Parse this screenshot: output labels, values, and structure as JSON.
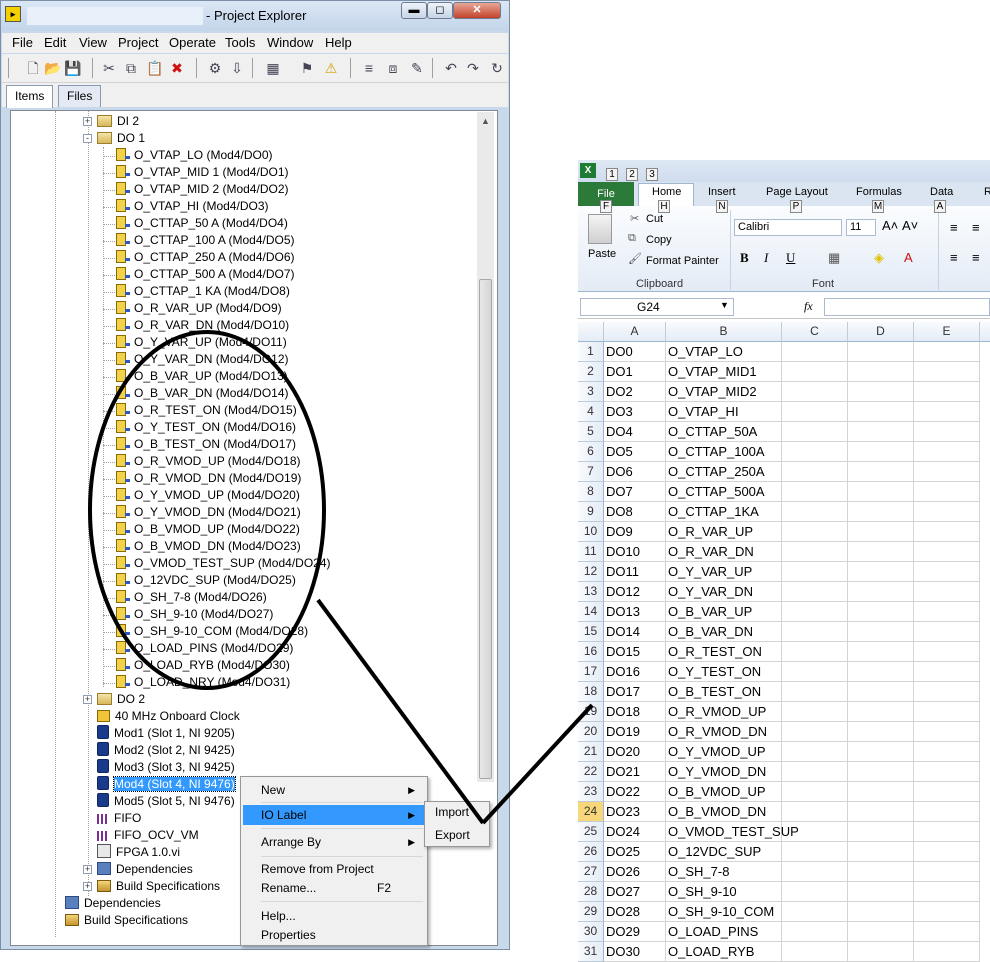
{
  "project_explorer": {
    "title": "- Project Explorer",
    "window_buttons": {
      "minimize": "▬",
      "maximize": "◻",
      "close": "✕"
    },
    "menu": [
      "File",
      "Edit",
      "View",
      "Project",
      "Operate",
      "Tools",
      "Window",
      "Help"
    ],
    "tabs": {
      "items": "Items",
      "files": "Files"
    },
    "tree": {
      "di2": "DI 2",
      "do1": "DO 1",
      "do1_items": [
        "O_VTAP_LO (Mod4/DO0)",
        "O_VTAP_MID 1 (Mod4/DO1)",
        "O_VTAP_MID 2 (Mod4/DO2)",
        "O_VTAP_HI (Mod4/DO3)",
        "O_CTTAP_50 A (Mod4/DO4)",
        "O_CTTAP_100 A (Mod4/DO5)",
        "O_CTTAP_250 A (Mod4/DO6)",
        "O_CTTAP_500 A (Mod4/DO7)",
        "O_CTTAP_1 KA (Mod4/DO8)",
        "O_R_VAR_UP (Mod4/DO9)",
        "O_R_VAR_DN (Mod4/DO10)",
        "O_Y_VAR_UP (Mod4/DO11)",
        "O_Y_VAR_DN (Mod4/DO12)",
        "O_B_VAR_UP (Mod4/DO13)",
        "O_B_VAR_DN (Mod4/DO14)",
        "O_R_TEST_ON (Mod4/DO15)",
        "O_Y_TEST_ON (Mod4/DO16)",
        "O_B_TEST_ON (Mod4/DO17)",
        "O_R_VMOD_UP (Mod4/DO18)",
        "O_R_VMOD_DN (Mod4/DO19)",
        "O_Y_VMOD_UP (Mod4/DO20)",
        "O_Y_VMOD_DN (Mod4/DO21)",
        "O_B_VMOD_UP (Mod4/DO22)",
        "O_B_VMOD_DN (Mod4/DO23)",
        "O_VMOD_TEST_SUP (Mod4/DO24)",
        "O_12VDC_SUP (Mod4/DO25)",
        "O_SH_7-8 (Mod4/DO26)",
        "O_SH_9-10 (Mod4/DO27)",
        "O_SH_9-10_COM (Mod4/DO28)",
        "O_LOAD_PINS (Mod4/DO29)",
        "O_LOAD_RYB (Mod4/DO30)",
        "O_LOAD_NRY (Mod4/DO31)"
      ],
      "do2": "DO 2",
      "clock": "40 MHz Onboard Clock",
      "modules": [
        "Mod1 (Slot 1, NI 9205)",
        "Mod2 (Slot 2, NI 9425)",
        "Mod3 (Slot 3, NI 9425)",
        "Mod4 (Slot 4, NI 9476)",
        "Mod5 (Slot 5, NI 9476)"
      ],
      "fifo": "FIFO",
      "fifo_ocv": "FIFO_OCV_VM",
      "fpga_vi": "FPGA 1.0.vi",
      "dependencies_inner": "Dependencies",
      "build_specs_inner": "Build Specifications",
      "dependencies_outer": "Dependencies",
      "build_specs_outer": "Build Specifications"
    },
    "context_menu": {
      "new": "New",
      "io_label": "IO Label",
      "arrange_by": "Arrange By",
      "remove": "Remove from Project",
      "rename": "Rename...",
      "rename_shortcut": "F2",
      "help": "Help...",
      "properties": "Properties"
    },
    "submenu": {
      "import": "Import",
      "export": "Export"
    }
  },
  "excel": {
    "qat_keytips": [
      "1",
      "2",
      "3"
    ],
    "tabs": {
      "file": "File",
      "home": "Home",
      "insert": "Insert",
      "page_layout": "Page Layout",
      "formulas": "Formulas",
      "data": "Data",
      "r": "R"
    },
    "tab_keytips": {
      "file": "F",
      "home": "H",
      "insert": "N",
      "page_layout": "P",
      "formulas": "M",
      "data": "A"
    },
    "clipboard": {
      "paste": "Paste",
      "cut": "Cut",
      "copy": "Copy",
      "format_painter": "Format Painter",
      "label": "Clipboard"
    },
    "font": {
      "name": "Calibri",
      "size": "11",
      "bold": "B",
      "italic": "I",
      "underline": "U",
      "label": "Font"
    },
    "name_box": "G24",
    "fx": "fx",
    "columns": [
      "A",
      "B",
      "C",
      "D",
      "E"
    ],
    "active_row": 24,
    "rows": [
      {
        "n": "1",
        "a": "DO0",
        "b": "O_VTAP_LO"
      },
      {
        "n": "2",
        "a": "DO1",
        "b": "O_VTAP_MID1"
      },
      {
        "n": "3",
        "a": "DO2",
        "b": "O_VTAP_MID2"
      },
      {
        "n": "4",
        "a": "DO3",
        "b": "O_VTAP_HI"
      },
      {
        "n": "5",
        "a": "DO4",
        "b": "O_CTTAP_50A"
      },
      {
        "n": "6",
        "a": "DO5",
        "b": "O_CTTAP_100A"
      },
      {
        "n": "7",
        "a": "DO6",
        "b": "O_CTTAP_250A"
      },
      {
        "n": "8",
        "a": "DO7",
        "b": "O_CTTAP_500A"
      },
      {
        "n": "9",
        "a": "DO8",
        "b": "O_CTTAP_1KA"
      },
      {
        "n": "10",
        "a": "DO9",
        "b": "O_R_VAR_UP"
      },
      {
        "n": "11",
        "a": "DO10",
        "b": "O_R_VAR_DN"
      },
      {
        "n": "12",
        "a": "DO11",
        "b": "O_Y_VAR_UP"
      },
      {
        "n": "13",
        "a": "DO12",
        "b": "O_Y_VAR_DN"
      },
      {
        "n": "14",
        "a": "DO13",
        "b": "O_B_VAR_UP"
      },
      {
        "n": "15",
        "a": "DO14",
        "b": "O_B_VAR_DN"
      },
      {
        "n": "16",
        "a": "DO15",
        "b": "O_R_TEST_ON"
      },
      {
        "n": "17",
        "a": "DO16",
        "b": "O_Y_TEST_ON"
      },
      {
        "n": "18",
        "a": "DO17",
        "b": "O_B_TEST_ON"
      },
      {
        "n": "19",
        "a": "DO18",
        "b": "O_R_VMOD_UP"
      },
      {
        "n": "20",
        "a": "DO19",
        "b": "O_R_VMOD_DN"
      },
      {
        "n": "21",
        "a": "DO20",
        "b": "O_Y_VMOD_UP"
      },
      {
        "n": "22",
        "a": "DO21",
        "b": "O_Y_VMOD_DN"
      },
      {
        "n": "23",
        "a": "DO22",
        "b": "O_B_VMOD_UP"
      },
      {
        "n": "24",
        "a": "DO23",
        "b": "O_B_VMOD_DN"
      },
      {
        "n": "25",
        "a": "DO24",
        "b": "O_VMOD_TEST_SUP"
      },
      {
        "n": "26",
        "a": "DO25",
        "b": "O_12VDC_SUP"
      },
      {
        "n": "27",
        "a": "DO26",
        "b": "O_SH_7-8"
      },
      {
        "n": "28",
        "a": "DO27",
        "b": "O_SH_9-10"
      },
      {
        "n": "29",
        "a": "DO28",
        "b": "O_SH_9-10_COM"
      },
      {
        "n": "30",
        "a": "DO29",
        "b": "O_LOAD_PINS"
      },
      {
        "n": "31",
        "a": "DO30",
        "b": "O_LOAD_RYB"
      }
    ]
  }
}
